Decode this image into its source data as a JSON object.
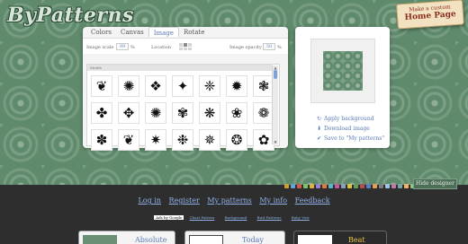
{
  "site": {
    "logo": "ByPatterns"
  },
  "promo": {
    "line1": "Make a custom",
    "line2": "Home Page"
  },
  "editor": {
    "tabs": [
      {
        "label": "Colors"
      },
      {
        "label": "Canvas"
      },
      {
        "label": "Image"
      },
      {
        "label": "Rotate"
      }
    ],
    "active_tab": "Image",
    "image_scale_label": "Image scale",
    "image_scale_value": "99",
    "image_scale_unit": "%",
    "location_label": "Location",
    "image_opacity_label": "Image opacity",
    "image_opacity_value": "50",
    "image_opacity_unit": "%",
    "motifs_header": "Motifs",
    "motifs": [
      "❦",
      "✺",
      "❖",
      "✦",
      "❈",
      "✹",
      "❃",
      "✤",
      "✥",
      "✺",
      "✾",
      "❋",
      "❀",
      "❁",
      "✽",
      "❦",
      "✷",
      "❉",
      "✵",
      "❂",
      "✿"
    ]
  },
  "preview": {
    "actions": [
      {
        "icon": "↻",
        "label": "Apply background"
      },
      {
        "icon": "⬇",
        "label": "Download image"
      },
      {
        "icon": "✔",
        "label": "Save to \"My patterns\""
      }
    ]
  },
  "toolbar": {
    "hide_label": "Hide designer",
    "icon_colors": [
      "#c9a13b",
      "#6aa0d8",
      "#d05a4b",
      "#7cc26e",
      "#e0b340",
      "#9b7fd1",
      "#e17b3a",
      "#5bb5c6",
      "#c45c9c",
      "#8aa2bd",
      "#d8c24a",
      "#6d9a5c",
      "#b05050",
      "#5a7ec0",
      "#e2a15a",
      "#7d7d7d",
      "#9fc5e8",
      "#c27ba0",
      "#76a5af",
      "#f6b26b",
      "#93c47d",
      "#8e7cc3",
      "#e06666"
    ]
  },
  "nav": {
    "links": [
      {
        "label": "Log in"
      },
      {
        "label": "Register"
      },
      {
        "label": "My patterns"
      },
      {
        "label": "My info"
      },
      {
        "label": "Feedback"
      }
    ]
  },
  "ads": {
    "label": "Ads by Google",
    "links": [
      {
        "label": "Chart Pattern"
      },
      {
        "label": "Background"
      },
      {
        "label": "Bird Patterns"
      },
      {
        "label": "Baby Vest"
      }
    ]
  },
  "cards": [
    {
      "title": "Absolute"
    },
    {
      "title": "Today"
    },
    {
      "title": "Beat them!"
    }
  ]
}
